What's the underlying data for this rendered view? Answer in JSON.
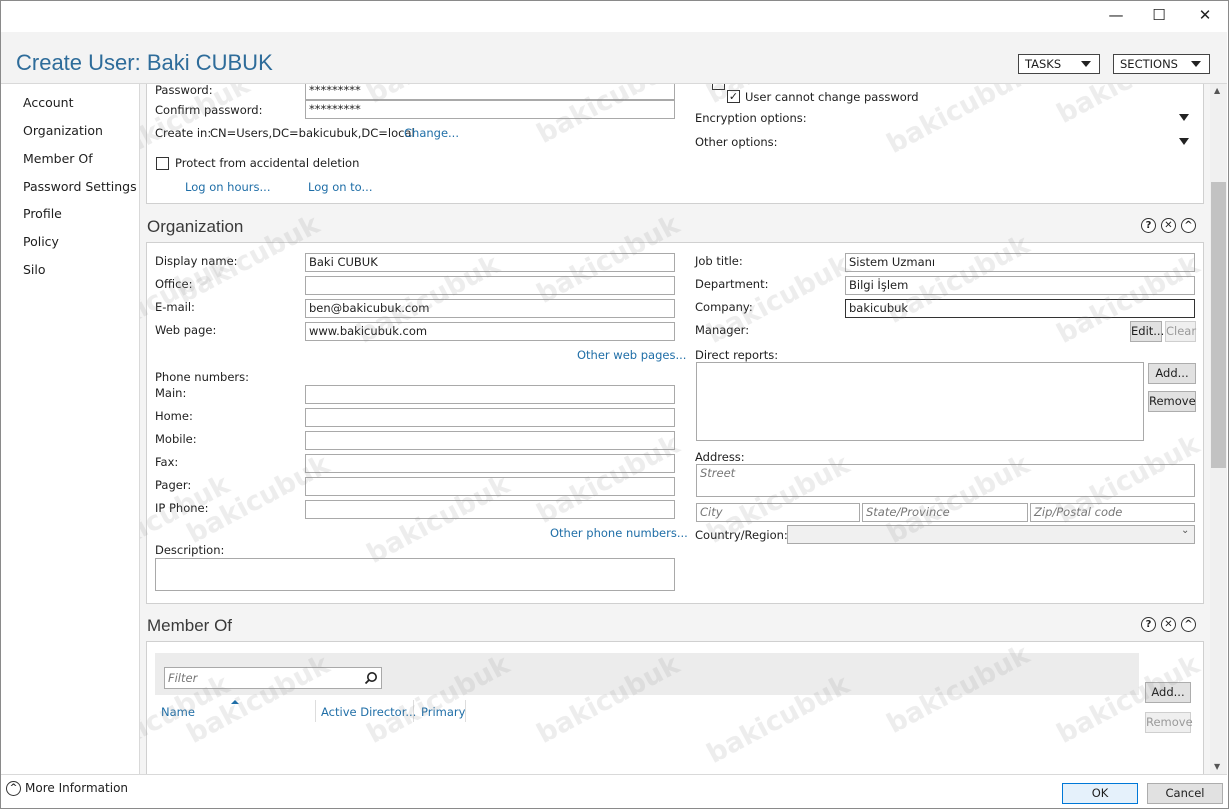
{
  "window": {
    "minimize": "—",
    "maximize": "☐",
    "close": "✕"
  },
  "header": {
    "title": "Create User: Baki CUBUK",
    "tasks": "TASKS",
    "sections": "SECTIONS"
  },
  "nav": [
    "Account",
    "Organization",
    "Member Of",
    "Password Settings",
    "Profile",
    "Policy",
    "Silo"
  ],
  "account": {
    "password_label": "Password:",
    "password_value": "*********",
    "confirm_label": "Confirm password:",
    "confirm_value": "*********",
    "create_in_label": "Create in:",
    "create_in_value": "CN=Users,DC=bakicubuk,DC=local",
    "change_link": "Change...",
    "protect_label": "Protect from accidental deletion",
    "logon_hours": "Log on hours...",
    "logon_to": "Log on to...",
    "cannot_change_label": "User cannot change password",
    "encryption_label": "Encryption options:",
    "other_label": "Other options:"
  },
  "organization": {
    "title": "Organization",
    "help": "?",
    "close": "✕",
    "collapse": "^",
    "display_name_label": "Display name:",
    "display_name": "Baki CUBUK",
    "office_label": "Office:",
    "office": "",
    "email_label": "E-mail:",
    "email": "ben@bakicubuk.com",
    "webpage_label": "Web page:",
    "webpage": "www.bakicubuk.com",
    "other_web": "Other web pages...",
    "phone_numbers": "Phone numbers:",
    "main_label": "Main:",
    "home_label": "Home:",
    "mobile_label": "Mobile:",
    "fax_label": "Fax:",
    "pager_label": "Pager:",
    "ipphone_label": "IP Phone:",
    "other_phone": "Other phone numbers...",
    "description_label": "Description:",
    "job_title_label": "Job title:",
    "job_title": "Sistem Uzmanı",
    "department_label": "Department:",
    "department": "Bilgi İşlem",
    "company_label": "Company:",
    "company": "bakicubuk",
    "manager_label": "Manager:",
    "edit_btn": "Edit...",
    "clear_btn": "Clear",
    "direct_reports_label": "Direct reports:",
    "add_btn": "Add...",
    "remove_btn": "Remove",
    "address_label": "Address:",
    "street_ph": "Street",
    "city_ph": "City",
    "state_ph": "State/Province",
    "zip_ph": "Zip/Postal code",
    "country_label": "Country/Region:"
  },
  "member_of": {
    "title": "Member Of",
    "help": "?",
    "close": "✕",
    "collapse": "^",
    "filter_ph": "Filter",
    "col_name": "Name",
    "col_ad": "Active Director...",
    "col_primary": "Primary",
    "add_btn": "Add...",
    "remove_btn": "Remove"
  },
  "footer": {
    "more_info": "More Information",
    "ok": "OK",
    "cancel": "Cancel"
  },
  "watermark": "bakicubuk"
}
